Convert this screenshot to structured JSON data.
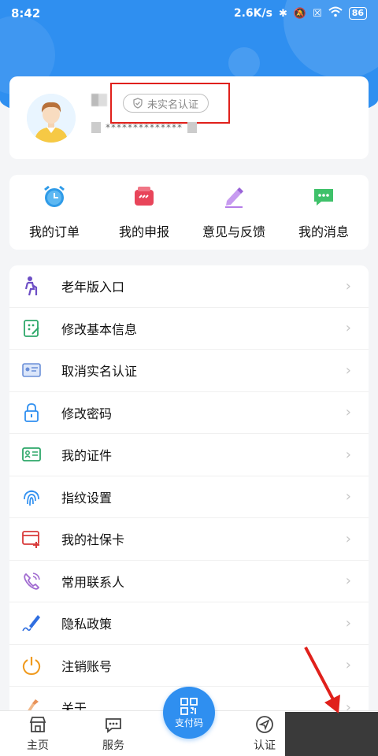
{
  "status_bar": {
    "time": "8:42",
    "network_speed": "2.6K/s",
    "battery": "86"
  },
  "profile": {
    "verify_badge": "未实名认证",
    "id_masked": "**************"
  },
  "quick_actions": [
    {
      "label": "我的订单",
      "icon": "alarm-clock-icon",
      "color": "#2f9be8"
    },
    {
      "label": "我的申报",
      "icon": "declare-icon",
      "color": "#e8455a"
    },
    {
      "label": "意见与反馈",
      "icon": "pencil-icon",
      "color": "#b57de8"
    },
    {
      "label": "我的消息",
      "icon": "chat-icon",
      "color": "#3fc16a"
    }
  ],
  "menu": [
    {
      "label": "老年版入口",
      "icon": "elder-icon",
      "color": "#6d4ec5"
    },
    {
      "label": "修改基本信息",
      "icon": "edit-info-icon",
      "color": "#2ea86a"
    },
    {
      "label": "取消实名认证",
      "icon": "id-card-icon",
      "color": "#6b8fd8"
    },
    {
      "label": "修改密码",
      "icon": "lock-icon",
      "color": "#2f8ff0"
    },
    {
      "label": "我的证件",
      "icon": "certificate-icon",
      "color": "#2ea86a"
    },
    {
      "label": "指纹设置",
      "icon": "fingerprint-icon",
      "color": "#2f8ff0"
    },
    {
      "label": "我的社保卡",
      "icon": "social-card-icon",
      "color": "#d83a3a"
    },
    {
      "label": "常用联系人",
      "icon": "contact-icon",
      "color": "#a06ad0"
    },
    {
      "label": "隐私政策",
      "icon": "privacy-pen-icon",
      "color": "#2f6ee0"
    },
    {
      "label": "注销账号",
      "icon": "power-icon",
      "color": "#f09a1e"
    },
    {
      "label": "关于",
      "icon": "about-icon",
      "color": "#e8935a"
    }
  ],
  "tabs": [
    {
      "label": "主页",
      "icon": "home-icon"
    },
    {
      "label": "服务",
      "icon": "service-icon"
    },
    {
      "label": "认证",
      "icon": "navigation-icon"
    }
  ],
  "pay_button": {
    "label": "支付码"
  },
  "chevron": "›"
}
